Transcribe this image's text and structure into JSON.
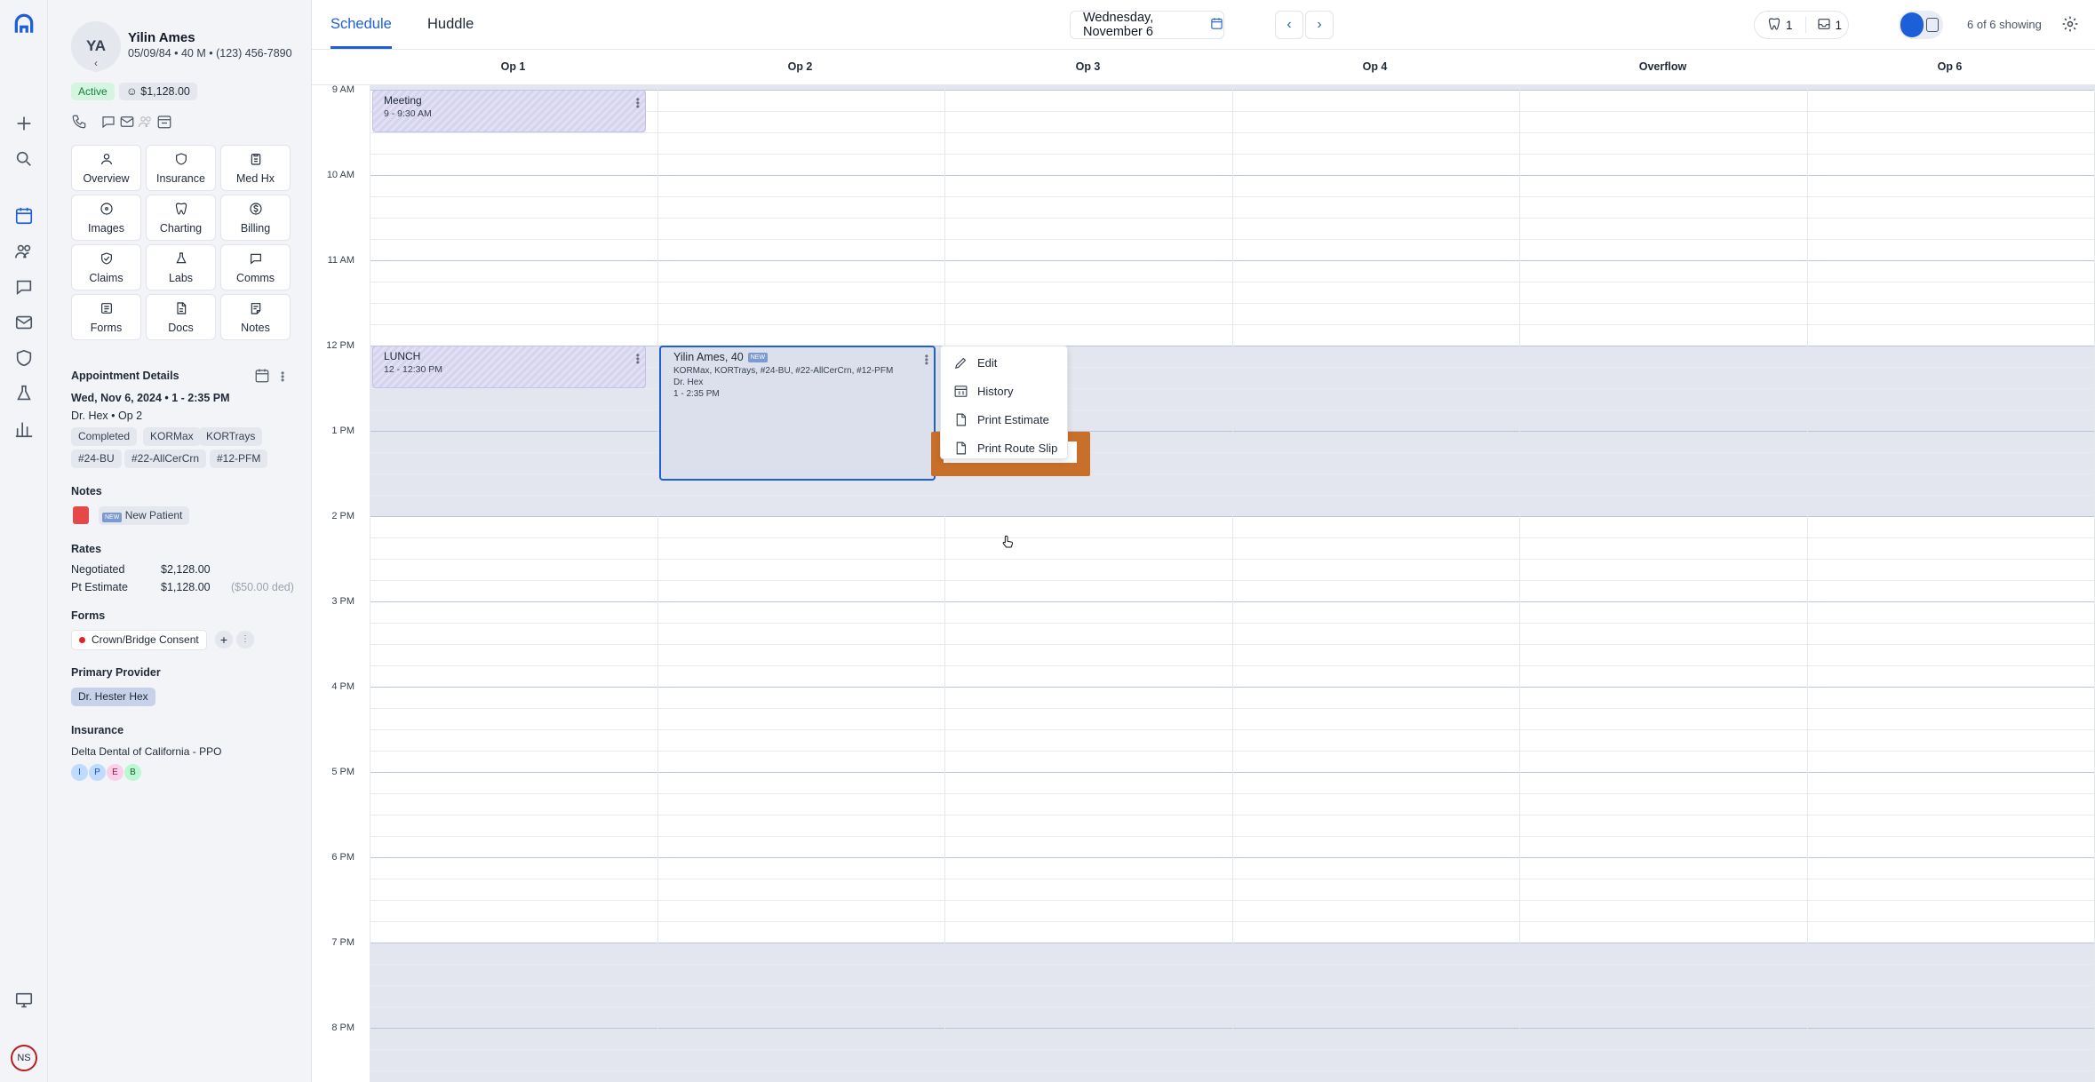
{
  "nav": {
    "user_initials": "NS"
  },
  "patient": {
    "initials": "YA",
    "name": "Yilin Ames",
    "info": "05/09/84 • 40 M • (123) 456-7890",
    "status": "Active",
    "balance": "$1,128.00"
  },
  "tiles": [
    {
      "label": "Overview",
      "icon": "person-icon"
    },
    {
      "label": "Insurance",
      "icon": "insurance-icon"
    },
    {
      "label": "Med Hx",
      "icon": "clipboard-icon"
    },
    {
      "label": "Images",
      "icon": "radiation-icon"
    },
    {
      "label": "Charting",
      "icon": "tooth-icon"
    },
    {
      "label": "Billing",
      "icon": "dollar-icon"
    },
    {
      "label": "Claims",
      "icon": "shield-check-icon"
    },
    {
      "label": "Labs",
      "icon": "flask-icon"
    },
    {
      "label": "Comms",
      "icon": "chat-icon"
    },
    {
      "label": "Forms",
      "icon": "form-icon"
    },
    {
      "label": "Docs",
      "icon": "document-icon"
    },
    {
      "label": "Notes",
      "icon": "note-icon"
    }
  ],
  "appointment": {
    "heading": "Appointment Details",
    "datetime": "Wed, Nov 6, 2024 • 1 - 2:35 PM",
    "provider_op": "Dr. Hex • Op 2",
    "tags": [
      "Completed",
      "KORMax",
      "KORTrays",
      "#24-BU",
      "#22-AllCerCrn",
      "#12-PFM"
    ]
  },
  "notes": {
    "heading": "Notes",
    "new_badge": "NEW",
    "label": "New Patient"
  },
  "rates": {
    "heading": "Rates",
    "negotiated_label": "Negotiated",
    "negotiated_value": "$2,128.00",
    "pt_label": "Pt Estimate",
    "pt_value": "$1,128.00",
    "pt_ded": "($50.00 ded)"
  },
  "forms": {
    "heading": "Forms",
    "item": "Crown/Bridge Consent"
  },
  "primary_provider": {
    "heading": "Primary Provider",
    "name": "Dr. Hester Hex"
  },
  "insurance": {
    "heading": "Insurance",
    "plan": "Delta Dental of California - PPO",
    "badges": [
      "I",
      "P",
      "E",
      "B"
    ]
  },
  "header": {
    "tabs": [
      "Schedule",
      "Huddle"
    ],
    "date": "Wednesday, November 6",
    "count_a": "1",
    "count_b": "1",
    "showing": "6 of 6 showing"
  },
  "columns": [
    "Op 1",
    "Op 2",
    "Op 3",
    "Op 4",
    "Overflow",
    "Op 6"
  ],
  "times": [
    "9 AM",
    "10 AM",
    "11 AM",
    "12 PM",
    "1 PM",
    "2 PM",
    "3 PM",
    "4 PM",
    "5 PM",
    "6 PM",
    "7 PM",
    "8 PM"
  ],
  "blocks": [
    {
      "title": "Meeting",
      "time": "9 - 9:30 AM"
    },
    {
      "title": "LUNCH",
      "time": "12 - 12:30 PM"
    }
  ],
  "appt_card": {
    "title": "Yilin Ames, 40",
    "new_badge": "NEW",
    "procedures": "KORMax, KORTrays, #24-BU, #22-AllCerCrn, #12-PFM",
    "provider": "Dr. Hex",
    "time": "1 - 2:35 PM"
  },
  "context_menu": [
    "Edit",
    "History",
    "Print Estimate",
    "Print Route Slip"
  ],
  "colors": {
    "accent": "#1d5fd6",
    "highlight": "#c8702a",
    "active_badge": "#d4f5df"
  }
}
